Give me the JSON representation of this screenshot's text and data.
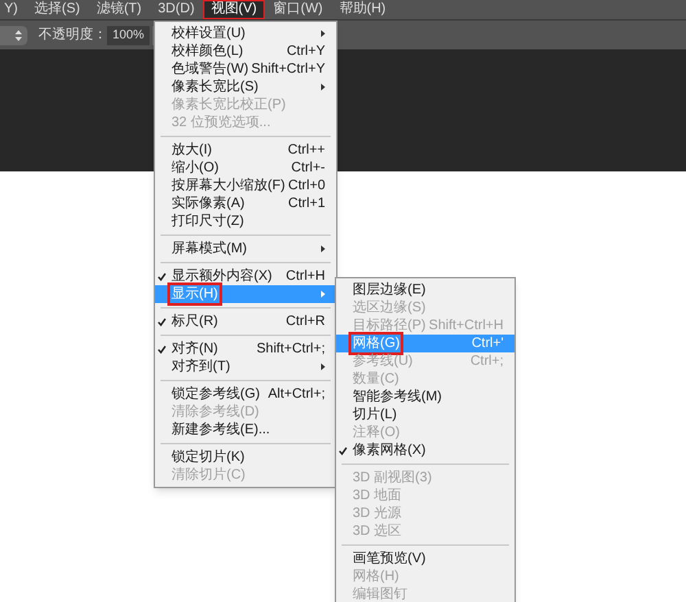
{
  "menubar": [
    {
      "label": "Y)",
      "selected": false,
      "annotated": false
    },
    {
      "label": "选择(S)",
      "selected": false,
      "annotated": false
    },
    {
      "label": "滤镜(T)",
      "selected": false,
      "annotated": false
    },
    {
      "label": "3D(D)",
      "selected": false,
      "annotated": false
    },
    {
      "label": "视图(V)",
      "selected": true,
      "annotated": true
    },
    {
      "label": "窗口(W)",
      "selected": false,
      "annotated": false
    },
    {
      "label": "帮助(H)",
      "selected": false,
      "annotated": false
    }
  ],
  "options_bar": {
    "opacity_label": "不透明度：",
    "opacity_value": "100%"
  },
  "view_menu": [
    {
      "kind": "item",
      "label": "校样设置(U)",
      "submenu": true,
      "disabled": false,
      "checked": false,
      "selected": false,
      "annotated": false
    },
    {
      "kind": "item",
      "label": "校样颜色(L)",
      "shortcut": "Ctrl+Y",
      "disabled": false,
      "checked": false,
      "selected": false,
      "annotated": false
    },
    {
      "kind": "item",
      "label": "色域警告(W)",
      "shortcut": "Shift+Ctrl+Y",
      "disabled": false,
      "checked": false,
      "selected": false,
      "annotated": false
    },
    {
      "kind": "item",
      "label": "像素长宽比(S)",
      "submenu": true,
      "disabled": false,
      "checked": false,
      "selected": false,
      "annotated": false
    },
    {
      "kind": "item",
      "label": "像素长宽比校正(P)",
      "disabled": true,
      "checked": false,
      "selected": false,
      "annotated": false
    },
    {
      "kind": "item",
      "label": "32 位预览选项...",
      "disabled": true,
      "checked": false,
      "selected": false,
      "annotated": false
    },
    {
      "kind": "separator"
    },
    {
      "kind": "item",
      "label": "放大(I)",
      "shortcut": "Ctrl++",
      "disabled": false,
      "checked": false,
      "selected": false,
      "annotated": false
    },
    {
      "kind": "item",
      "label": "缩小(O)",
      "shortcut": "Ctrl+-",
      "disabled": false,
      "checked": false,
      "selected": false,
      "annotated": false
    },
    {
      "kind": "item",
      "label": "按屏幕大小缩放(F)",
      "shortcut": "Ctrl+0",
      "disabled": false,
      "checked": false,
      "selected": false,
      "annotated": false
    },
    {
      "kind": "item",
      "label": "实际像素(A)",
      "shortcut": "Ctrl+1",
      "disabled": false,
      "checked": false,
      "selected": false,
      "annotated": false
    },
    {
      "kind": "item",
      "label": "打印尺寸(Z)",
      "disabled": false,
      "checked": false,
      "selected": false,
      "annotated": false
    },
    {
      "kind": "separator"
    },
    {
      "kind": "item",
      "label": "屏幕模式(M)",
      "submenu": true,
      "disabled": false,
      "checked": false,
      "selected": false,
      "annotated": false
    },
    {
      "kind": "separator"
    },
    {
      "kind": "item",
      "label": "显示额外内容(X)",
      "shortcut": "Ctrl+H",
      "disabled": false,
      "checked": true,
      "selected": false,
      "annotated": false
    },
    {
      "kind": "item",
      "label": "显示(H)",
      "submenu": true,
      "disabled": false,
      "checked": false,
      "selected": true,
      "annotated": true
    },
    {
      "kind": "separator"
    },
    {
      "kind": "item",
      "label": "标尺(R)",
      "shortcut": "Ctrl+R",
      "disabled": false,
      "checked": true,
      "selected": false,
      "annotated": false
    },
    {
      "kind": "separator"
    },
    {
      "kind": "item",
      "label": "对齐(N)",
      "shortcut": "Shift+Ctrl+;",
      "disabled": false,
      "checked": true,
      "selected": false,
      "annotated": false
    },
    {
      "kind": "item",
      "label": "对齐到(T)",
      "submenu": true,
      "disabled": false,
      "checked": false,
      "selected": false,
      "annotated": false
    },
    {
      "kind": "separator"
    },
    {
      "kind": "item",
      "label": "锁定参考线(G)",
      "shortcut": "Alt+Ctrl+;",
      "disabled": false,
      "checked": false,
      "selected": false,
      "annotated": false
    },
    {
      "kind": "item",
      "label": "清除参考线(D)",
      "disabled": true,
      "checked": false,
      "selected": false,
      "annotated": false
    },
    {
      "kind": "item",
      "label": "新建参考线(E)...",
      "disabled": false,
      "checked": false,
      "selected": false,
      "annotated": false
    },
    {
      "kind": "separator"
    },
    {
      "kind": "item",
      "label": "锁定切片(K)",
      "disabled": false,
      "checked": false,
      "selected": false,
      "annotated": false
    },
    {
      "kind": "item",
      "label": "清除切片(C)",
      "disabled": true,
      "checked": false,
      "selected": false,
      "annotated": false
    }
  ],
  "show_submenu": [
    {
      "kind": "item",
      "label": "图层边缘(E)",
      "disabled": false,
      "checked": false,
      "selected": false,
      "annotated": false
    },
    {
      "kind": "item",
      "label": "选区边缘(S)",
      "disabled": true,
      "checked": false,
      "selected": false,
      "annotated": false
    },
    {
      "kind": "item",
      "label": "目标路径(P)",
      "shortcut": "Shift+Ctrl+H",
      "disabled": true,
      "checked": false,
      "selected": false,
      "annotated": false
    },
    {
      "kind": "item",
      "label": "网格(G)",
      "shortcut": "Ctrl+'",
      "disabled": false,
      "checked": false,
      "selected": true,
      "annotated": true
    },
    {
      "kind": "item",
      "label": "参考线(U)",
      "shortcut": "Ctrl+;",
      "disabled": true,
      "checked": false,
      "selected": false,
      "annotated": false
    },
    {
      "kind": "item",
      "label": "数量(C)",
      "disabled": true,
      "checked": false,
      "selected": false,
      "annotated": false
    },
    {
      "kind": "item",
      "label": "智能参考线(M)",
      "disabled": false,
      "checked": false,
      "selected": false,
      "annotated": false
    },
    {
      "kind": "item",
      "label": "切片(L)",
      "disabled": false,
      "checked": false,
      "selected": false,
      "annotated": false
    },
    {
      "kind": "item",
      "label": "注释(O)",
      "disabled": true,
      "checked": false,
      "selected": false,
      "annotated": false
    },
    {
      "kind": "item",
      "label": "像素网格(X)",
      "disabled": false,
      "checked": true,
      "selected": false,
      "annotated": false
    },
    {
      "kind": "separator"
    },
    {
      "kind": "item",
      "label": "3D 副视图(3)",
      "disabled": true,
      "checked": false,
      "selected": false,
      "annotated": false
    },
    {
      "kind": "item",
      "label": "3D 地面",
      "disabled": true,
      "checked": false,
      "selected": false,
      "annotated": false
    },
    {
      "kind": "item",
      "label": "3D 光源",
      "disabled": true,
      "checked": false,
      "selected": false,
      "annotated": false
    },
    {
      "kind": "item",
      "label": "3D 选区",
      "disabled": true,
      "checked": false,
      "selected": false,
      "annotated": false
    },
    {
      "kind": "separator"
    },
    {
      "kind": "item",
      "label": "画笔预览(V)",
      "disabled": false,
      "checked": false,
      "selected": false,
      "annotated": false
    },
    {
      "kind": "item",
      "label": "网格(H)",
      "disabled": true,
      "checked": false,
      "selected": false,
      "annotated": false
    },
    {
      "kind": "item",
      "label": "编辑图钉",
      "disabled": true,
      "checked": false,
      "selected": false,
      "annotated": false
    }
  ]
}
